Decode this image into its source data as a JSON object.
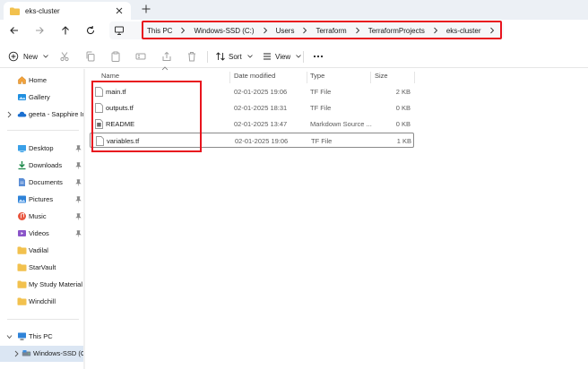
{
  "tab": {
    "title": "eks-cluster"
  },
  "nav": {
    "breadcrumbs": [
      "This PC",
      "Windows-SSD (C:)",
      "Users",
      "Terraform",
      "TerraformProjects",
      "eks-cluster"
    ]
  },
  "toolbar": {
    "new_label": "New",
    "sort_label": "Sort",
    "view_label": "View"
  },
  "sidebar": {
    "home": "Home",
    "gallery": "Gallery",
    "account": "geeta - Sapphire In",
    "quick": [
      {
        "label": "Desktop",
        "icon": "desktop-icon",
        "pinned": true
      },
      {
        "label": "Downloads",
        "icon": "download-icon",
        "pinned": true
      },
      {
        "label": "Documents",
        "icon": "documents-icon",
        "pinned": true
      },
      {
        "label": "Pictures",
        "icon": "pictures-icon",
        "pinned": true
      },
      {
        "label": "Music",
        "icon": "music-icon",
        "pinned": true
      },
      {
        "label": "Videos",
        "icon": "videos-icon",
        "pinned": true
      },
      {
        "label": "Vadilal",
        "icon": "folder-icon",
        "pinned": false
      },
      {
        "label": "StarVault",
        "icon": "folder-icon",
        "pinned": false
      },
      {
        "label": "My Study Material",
        "icon": "folder-icon",
        "pinned": false
      },
      {
        "label": "Windchill",
        "icon": "folder-icon",
        "pinned": false
      }
    ],
    "this_pc": "This PC",
    "drive": "Windows-SSD (C:)"
  },
  "columns": {
    "name": "Name",
    "date": "Date modified",
    "type": "Type",
    "size": "Size"
  },
  "files": [
    {
      "name": "main.tf",
      "date": "02-01-2025 19:06",
      "type": "TF File",
      "size": "2 KB"
    },
    {
      "name": "outputs.tf",
      "date": "02-01-2025 18:31",
      "type": "TF File",
      "size": "0 KB"
    },
    {
      "name": "README",
      "date": "02-01-2025 13:47",
      "type": "Markdown Source ...",
      "size": "0 KB"
    },
    {
      "name": "variables.tf",
      "date": "02-01-2025 19:06",
      "type": "TF File",
      "size": "1 KB"
    }
  ],
  "colors": {
    "highlight_red": "#e8141e",
    "selection": "#dbe6f3",
    "folder": "#f2c14e",
    "accent": "#0067c0"
  }
}
